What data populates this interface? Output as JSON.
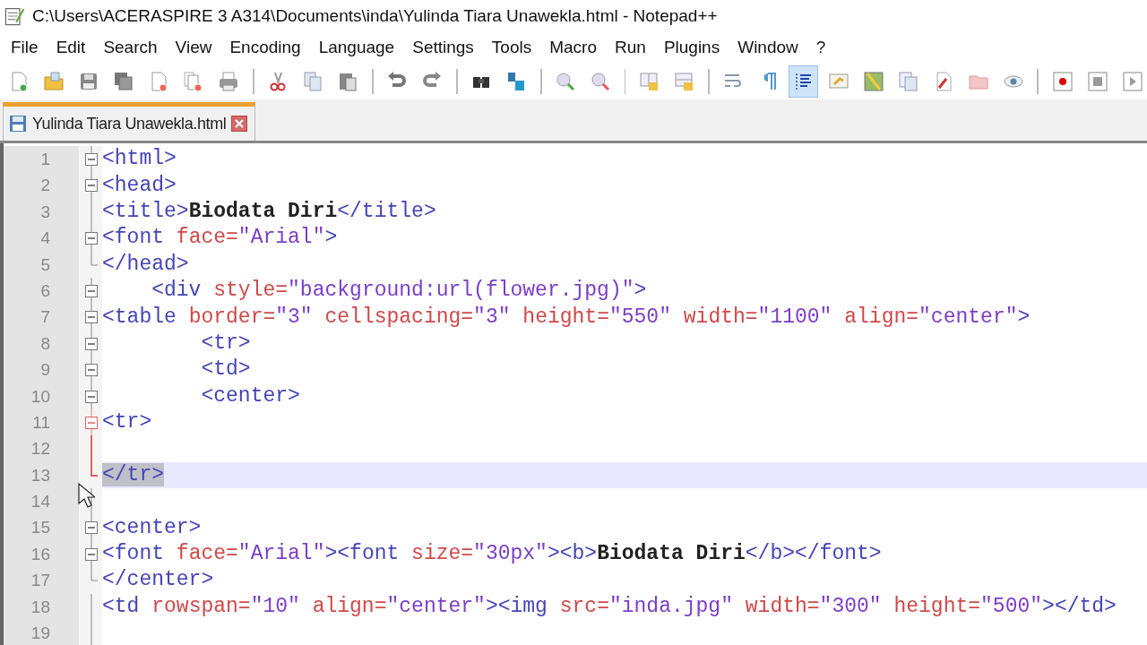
{
  "window": {
    "title": "C:\\Users\\ACERASPIRE 3 A314\\Documents\\inda\\Yulinda Tiara Unawekla.html - Notepad++"
  },
  "menu": [
    "File",
    "Edit",
    "Search",
    "View",
    "Encoding",
    "Language",
    "Settings",
    "Tools",
    "Macro",
    "Run",
    "Plugins",
    "Window",
    "?"
  ],
  "toolbar": [
    {
      "pressed": false
    },
    {
      "pressed": false
    },
    {
      "pressed": false
    },
    {
      "pressed": false
    },
    {
      "pressed": false
    },
    {
      "pressed": false
    },
    {
      "pressed": false
    },
    {
      "pressed": false
    },
    {
      "pressed": false
    },
    {
      "pressed": false
    },
    {
      "pressed": false
    },
    {
      "pressed": false
    },
    {
      "pressed": false
    },
    {
      "pressed": false
    },
    {
      "pressed": false
    },
    {
      "pressed": false
    },
    {
      "pressed": false
    },
    {
      "pressed": false
    },
    {
      "pressed": false
    },
    {
      "pressed": false
    },
    {
      "pressed": true
    },
    {
      "pressed": false
    },
    {
      "pressed": false
    },
    {
      "pressed": false
    },
    {
      "pressed": false
    },
    {
      "pressed": false
    },
    {
      "pressed": false
    },
    {
      "pressed": false
    },
    {
      "pressed": false
    },
    {
      "pressed": false
    }
  ],
  "tabs": [
    {
      "label": "Yulinda Tiara Unawekla.html",
      "selected": true
    }
  ],
  "editor": {
    "lines": [
      {
        "number": "1",
        "fold": {
          "kind": "open",
          "active": false
        },
        "current": false,
        "tokens": [
          {
            "kind": "tag",
            "text": "<html>"
          }
        ]
      },
      {
        "number": "2",
        "fold": {
          "kind": "open",
          "active": false
        },
        "current": false,
        "tokens": [
          {
            "kind": "tag",
            "text": "<head>"
          }
        ]
      },
      {
        "number": "3",
        "fold": {
          "kind": "line",
          "active": false
        },
        "current": false,
        "tokens": [
          {
            "kind": "tag",
            "text": "<title>"
          },
          {
            "kind": "text",
            "text": "Biodata Diri"
          },
          {
            "kind": "tag",
            "text": "</title>"
          }
        ]
      },
      {
        "number": "4",
        "fold": {
          "kind": "open",
          "active": false
        },
        "current": false,
        "tokens": [
          {
            "kind": "tag",
            "text": "<font "
          },
          {
            "kind": "attr",
            "text": "face="
          },
          {
            "kind": "value",
            "text": "\"Arial\""
          },
          {
            "kind": "tag",
            "text": ">"
          }
        ]
      },
      {
        "number": "5",
        "fold": {
          "kind": "end",
          "active": false
        },
        "current": false,
        "tokens": [
          {
            "kind": "tag",
            "text": "</head>"
          }
        ]
      },
      {
        "number": "6",
        "fold": {
          "kind": "open",
          "active": false
        },
        "current": false,
        "tokens": [
          {
            "kind": "tag",
            "text": "    <div "
          },
          {
            "kind": "attr",
            "text": "style="
          },
          {
            "kind": "value",
            "text": "\"background:url(flower.jpg)\""
          },
          {
            "kind": "tag",
            "text": ">"
          }
        ]
      },
      {
        "number": "7",
        "fold": {
          "kind": "open",
          "active": false
        },
        "current": false,
        "tokens": [
          {
            "kind": "tag",
            "text": "<table "
          },
          {
            "kind": "attr",
            "text": "border="
          },
          {
            "kind": "value",
            "text": "\"3\" "
          },
          {
            "kind": "attr",
            "text": "cellspacing="
          },
          {
            "kind": "value",
            "text": "\"3\" "
          },
          {
            "kind": "attr",
            "text": "height="
          },
          {
            "kind": "value",
            "text": "\"550\" "
          },
          {
            "kind": "attr",
            "text": "width="
          },
          {
            "kind": "value",
            "text": "\"1100\" "
          },
          {
            "kind": "attr",
            "text": "align="
          },
          {
            "kind": "value",
            "text": "\"center\""
          },
          {
            "kind": "tag",
            "text": ">"
          }
        ]
      },
      {
        "number": "8",
        "fold": {
          "kind": "open",
          "active": false
        },
        "current": false,
        "tokens": [
          {
            "kind": "tag",
            "text": "        <tr>"
          }
        ]
      },
      {
        "number": "9",
        "fold": {
          "kind": "open",
          "active": false
        },
        "current": false,
        "tokens": [
          {
            "kind": "tag",
            "text": "        <td>"
          }
        ]
      },
      {
        "number": "10",
        "fold": {
          "kind": "open",
          "active": false
        },
        "current": false,
        "tokens": [
          {
            "kind": "tag",
            "text": "        <center>"
          }
        ]
      },
      {
        "number": "11",
        "fold": {
          "kind": "open",
          "active": true
        },
        "current": false,
        "tokens": [
          {
            "kind": "tag",
            "text": "<tr>"
          }
        ]
      },
      {
        "number": "12",
        "fold": {
          "kind": "line",
          "active": true
        },
        "current": false
      },
      {
        "number": "13",
        "fold": {
          "kind": "end",
          "active": true
        },
        "current": true,
        "tokens": [
          {
            "kind": "selection",
            "text": "</tr>"
          }
        ]
      },
      {
        "number": "14",
        "fold": {
          "kind": "line",
          "active": false
        },
        "current": false
      },
      {
        "number": "15",
        "fold": {
          "kind": "open",
          "active": false
        },
        "current": false,
        "tokens": [
          {
            "kind": "tag",
            "text": "<center>"
          }
        ]
      },
      {
        "number": "16",
        "fold": {
          "kind": "open",
          "active": false
        },
        "current": false,
        "tokens": [
          {
            "kind": "tag",
            "text": "<font "
          },
          {
            "kind": "attr",
            "text": "face="
          },
          {
            "kind": "value",
            "text": "\"Arial\""
          },
          {
            "kind": "tag",
            "text": "><font "
          },
          {
            "kind": "attr",
            "text": "size="
          },
          {
            "kind": "value",
            "text": "\"30px\""
          },
          {
            "kind": "tag",
            "text": "><b>"
          },
          {
            "kind": "text",
            "text": "Biodata Diri"
          },
          {
            "kind": "tag",
            "text": "</b></font>"
          }
        ]
      },
      {
        "number": "17",
        "fold": {
          "kind": "end",
          "active": false
        },
        "current": false,
        "tokens": [
          {
            "kind": "tag",
            "text": "</center>"
          }
        ]
      },
      {
        "number": "18",
        "fold": {
          "kind": "line",
          "active": false
        },
        "current": false,
        "tokens": [
          {
            "kind": "tag",
            "text": "<td "
          },
          {
            "kind": "attr",
            "text": "rowspan="
          },
          {
            "kind": "value",
            "text": "\"10\" "
          },
          {
            "kind": "attr",
            "text": "align="
          },
          {
            "kind": "value",
            "text": "\"center\""
          },
          {
            "kind": "tag",
            "text": "><img "
          },
          {
            "kind": "attr",
            "text": "src="
          },
          {
            "kind": "value",
            "text": "\"inda.jpg\" "
          },
          {
            "kind": "attr",
            "text": "width="
          },
          {
            "kind": "value",
            "text": "\"300\" "
          },
          {
            "kind": "attr",
            "text": "height="
          },
          {
            "kind": "value",
            "text": "\"500\""
          },
          {
            "kind": "tag",
            "text": "></td>"
          }
        ]
      },
      {
        "number": "19",
        "fold": {
          "kind": "line",
          "active": false
        },
        "current": false
      }
    ]
  }
}
